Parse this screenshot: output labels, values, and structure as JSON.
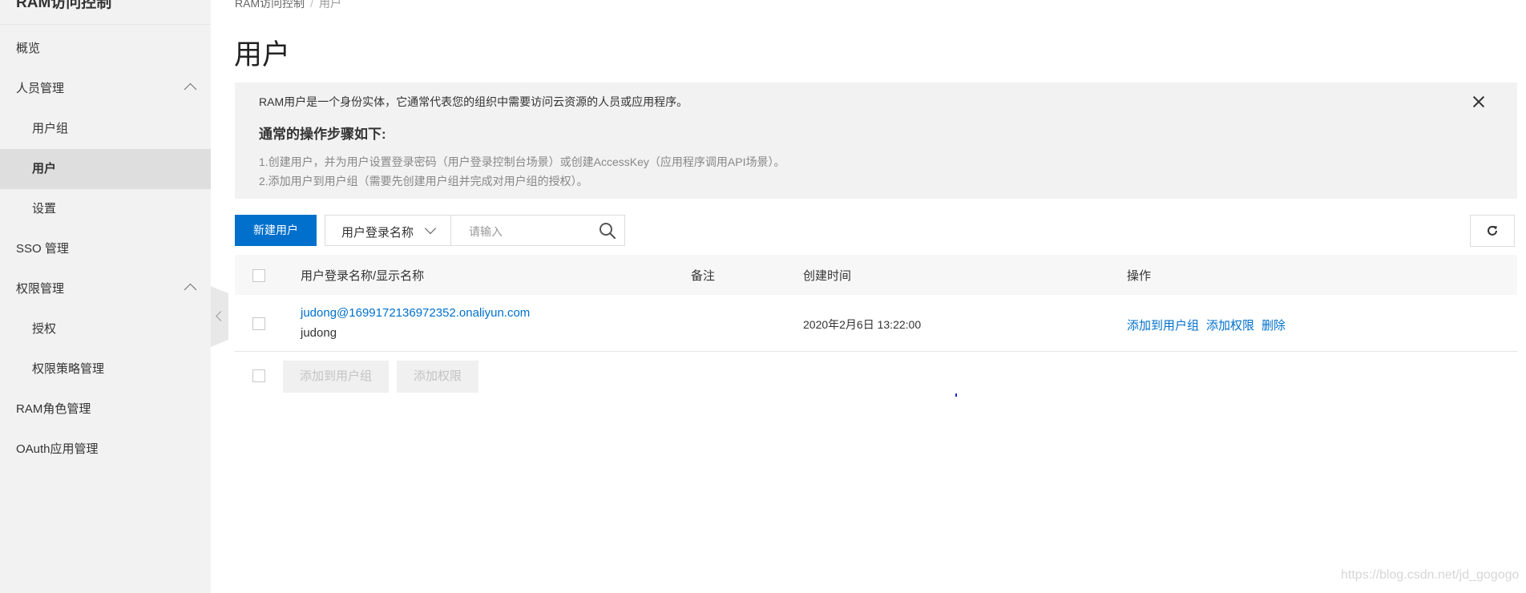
{
  "sidebar": {
    "title": "RAM访问控制",
    "items": [
      {
        "label": "概览"
      },
      {
        "label": "人员管理"
      },
      {
        "label": "用户组"
      },
      {
        "label": "用户"
      },
      {
        "label": "设置"
      },
      {
        "label": "SSO 管理"
      },
      {
        "label": "权限管理"
      },
      {
        "label": "授权"
      },
      {
        "label": "权限策略管理"
      },
      {
        "label": "RAM角色管理"
      },
      {
        "label": "OAuth应用管理"
      }
    ]
  },
  "breadcrumb": {
    "parent": "RAM访问控制",
    "separator": "/",
    "current": "用户"
  },
  "page_title": "用户",
  "notice": {
    "description": "RAM用户是一个身份实体，它通常代表您的组织中需要访问云资源的人员或应用程序。",
    "steps_title": "通常的操作步骤如下:",
    "steps": [
      "1.创建用户，并为用户设置登录密码（用户登录控制台场景）或创建AccessKey（应用程序调用API场景）。",
      "2.添加用户到用户组（需要先创建用户组并完成对用户组的授权）。"
    ]
  },
  "toolbar": {
    "create_label": "新建用户",
    "filter_selected": "用户登录名称",
    "search_placeholder": "请输入"
  },
  "table": {
    "columns": [
      "用户登录名称/显示名称",
      "备注",
      "创建时间",
      "操作"
    ],
    "rows": [
      {
        "login_name": "judong@1699172136972352.onaliyun.com",
        "display_name": "judong",
        "note": "",
        "created": "2020年2月6日 13:22:00",
        "actions": [
          "添加到用户组",
          "添加权限",
          "删除"
        ]
      }
    ]
  },
  "batch": {
    "add_to_group": "添加到用户组",
    "add_permission": "添加权限"
  },
  "watermark": "https://blog.csdn.net/jd_gogogo",
  "colors": {
    "primary": "#0070cc",
    "sidebar_bg": "#f2f2f2",
    "active_bg": "#dedede",
    "notice_bg": "#f2f2f2"
  }
}
